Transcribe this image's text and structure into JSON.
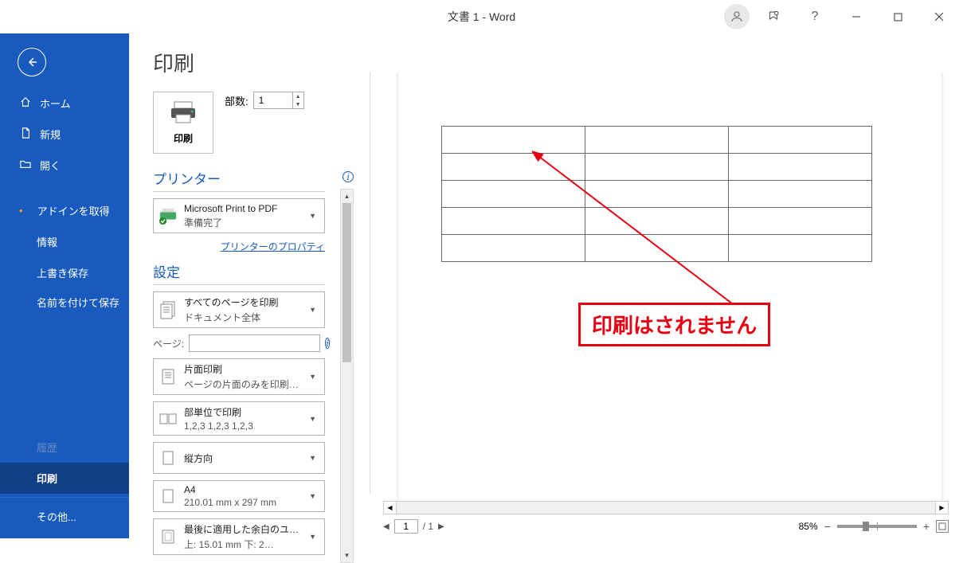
{
  "titlebar": {
    "title": "文書 1  -  Word",
    "help": "?"
  },
  "sidebar": {
    "home": "ホーム",
    "new": "新規",
    "open": "開く",
    "getaddins": "アドインを取得",
    "info": "情報",
    "save": "上書き保存",
    "saveas": "名前を付けて保存",
    "history": "履歴",
    "print": "印刷",
    "other": "その他..."
  },
  "content": {
    "title": "印刷",
    "print_button": "印刷",
    "copies_label": "部数:",
    "copies_value": "1",
    "printer_section": "プリンター",
    "printer_name": "Microsoft Print to PDF",
    "printer_status": "準備完了",
    "printer_props": "プリンターのプロパティ",
    "settings_section": "設定",
    "pages_label": "ページ:",
    "pages_value": "",
    "dropdowns": {
      "pages": {
        "l1": "すべてのページを印刷",
        "l2": "ドキュメント全体"
      },
      "side": {
        "l1": "片面印刷",
        "l2": "ページの片面のみを印刷…"
      },
      "collate": {
        "l1": "部単位で印刷",
        "l2": "1,2,3    1,2,3    1,2,3"
      },
      "orient": {
        "l1": "縦方向",
        "l2": ""
      },
      "paper": {
        "l1": "A4",
        "l2": "210.01 mm x 297 mm"
      },
      "margin": {
        "l1": "最後に適用した余白のユ…",
        "l2": "上: 15.01 mm 下: 2…"
      }
    }
  },
  "preview": {
    "annotation": "印刷はされません",
    "current_page": "1",
    "total_pages": "/ 1",
    "zoom": "85%"
  }
}
